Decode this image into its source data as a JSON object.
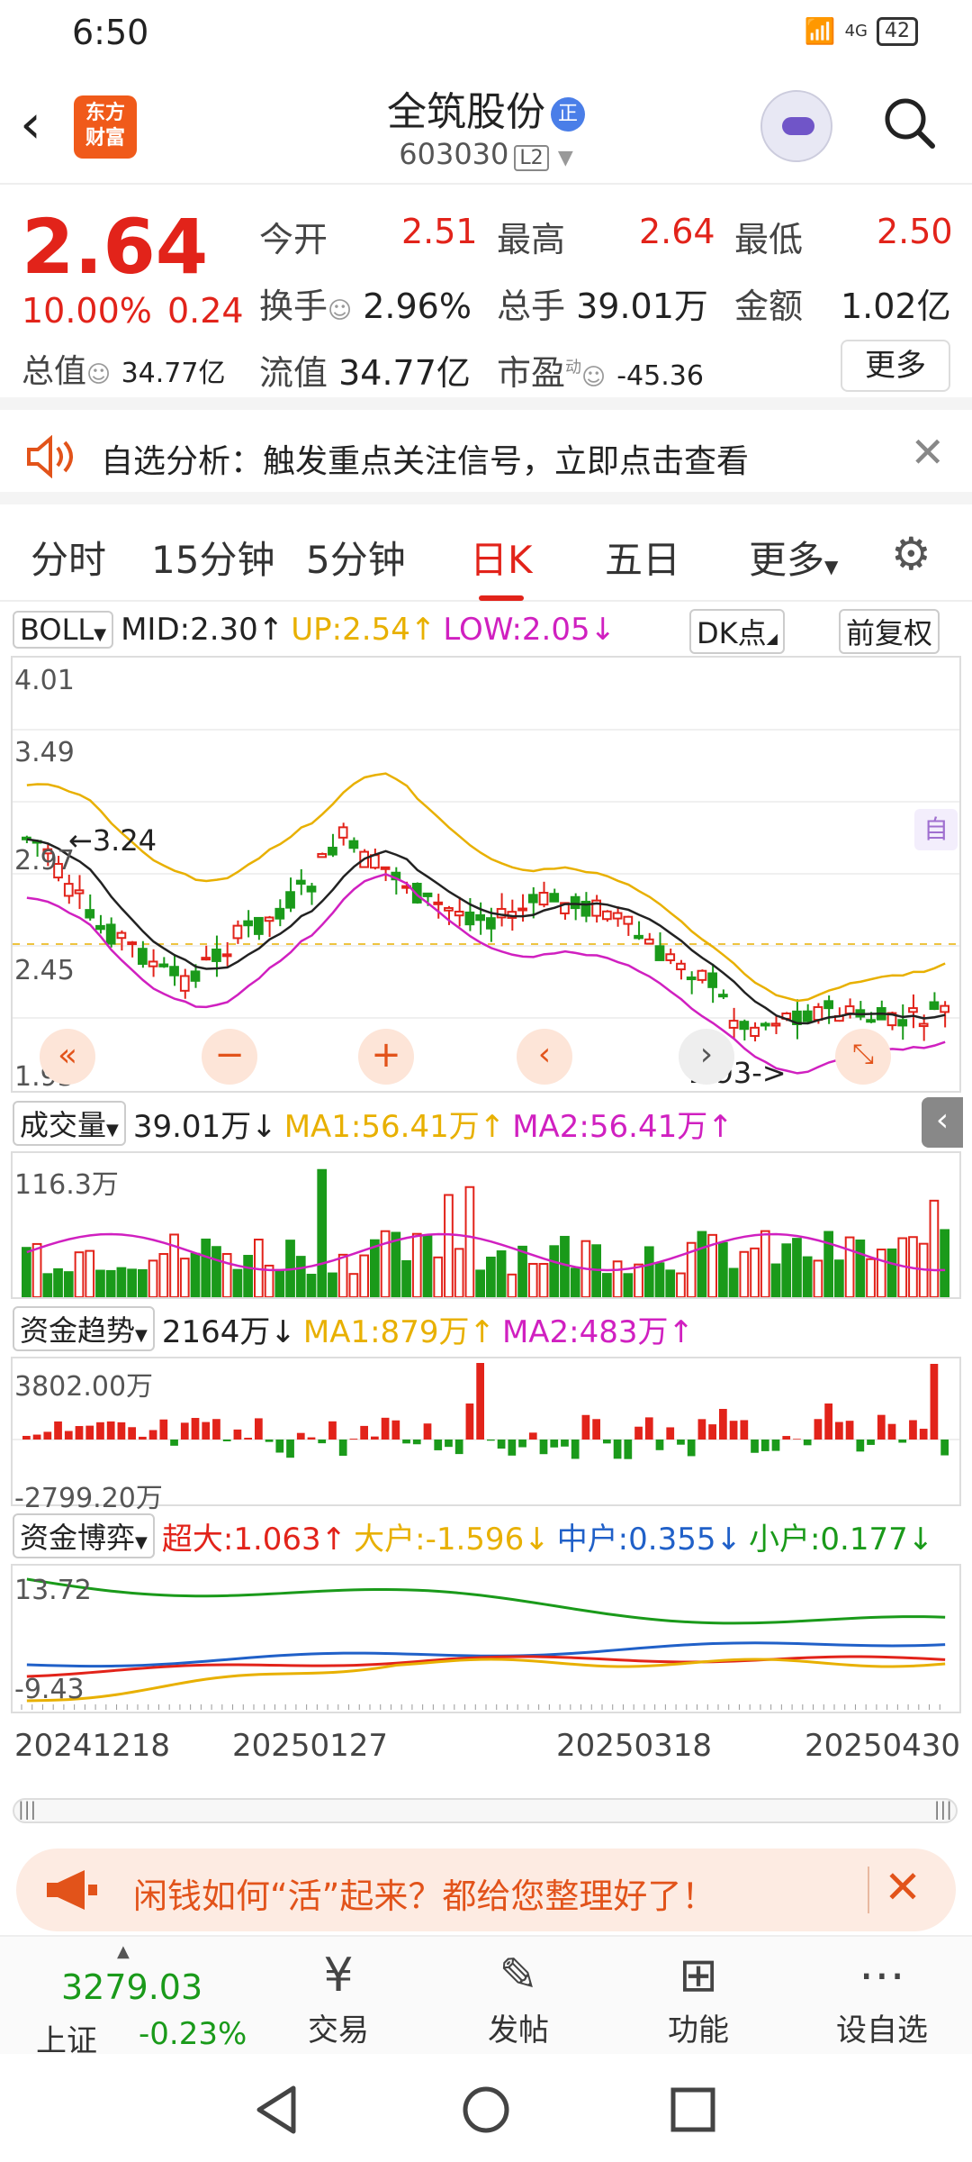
{
  "status": {
    "time": "6:50",
    "signal": "4G",
    "battery": "42"
  },
  "nav": {
    "back_glyph": "‹",
    "logo_text": "东方\n财富",
    "title": "全筑股份",
    "badge": "正",
    "code": "603030",
    "level": "L2"
  },
  "quote": {
    "price": "2.64",
    "pct": "10.00%",
    "change": "0.24",
    "open_label": "今开",
    "open": "2.51",
    "high_label": "最高",
    "high": "2.64",
    "low_label": "最低",
    "low": "2.50",
    "turnover_label": "换手",
    "turnover": "2.96%",
    "vol_label": "总手",
    "vol": "39.01万",
    "amount_label": "金额",
    "amount": "1.02亿",
    "mcap_label": "总值",
    "mcap": "34.77亿",
    "float_label": "流值",
    "float": "34.77亿",
    "pe_label": "市盈",
    "pe_sup": "动",
    "pe": "-45.36",
    "more_label": "更多"
  },
  "banner1": {
    "text": "自选分析：触发重点关注信号，立即点击查看"
  },
  "tabs": [
    {
      "label": "分时"
    },
    {
      "label": "15分钟"
    },
    {
      "label": "5分钟"
    },
    {
      "label": "日K"
    },
    {
      "label": "五日"
    },
    {
      "label": "更多"
    }
  ],
  "boll": {
    "name": "BOLL",
    "mid": "MID:2.30↑",
    "up": "UP:2.54↑",
    "low": "LOW:2.05↓",
    "dk": "DK点",
    "adj": "前复权",
    "y_labels": [
      "4.01",
      "3.49",
      "2.97",
      "2.45",
      "1.93"
    ],
    "max_note": "←3.24",
    "min_note": "1.93->",
    "self_tag": "自"
  },
  "volume": {
    "name": "成交量",
    "value": "39.01万↓",
    "ma1": "MA1:56.41万↑",
    "ma2": "MA2:56.41万↑",
    "top_label": "116.3万"
  },
  "fund_trend": {
    "name": "资金趋势",
    "value": "2164万↓",
    "ma1": "MA1:879万↑",
    "ma2": "MA2:483万↑",
    "top_label": "3802.00万",
    "bottom_label": "-2799.20万"
  },
  "fund_game": {
    "name": "资金博弈",
    "super": "超大:1.063↑",
    "big": "大户:-1.596↓",
    "mid": "中户:0.355↓",
    "small": "小户:0.177↓",
    "top_label": "13.72",
    "bottom_label": "-9.43"
  },
  "dates": [
    "20241218",
    "20250127",
    "20250318",
    "20250430"
  ],
  "banner2": {
    "text": "闲钱如何“活”起来？都给您整理好了！"
  },
  "bottom": {
    "index_value": "3279.03",
    "index_name": "上证",
    "index_change": "-0.23%",
    "items": [
      {
        "label": "交易"
      },
      {
        "label": "发帖"
      },
      {
        "label": "功能"
      },
      {
        "label": "设自选"
      }
    ]
  },
  "colors": {
    "up": "#e2231a",
    "down": "#1a9a1a",
    "mid_line": "#222222",
    "upper_band": "#e8b000",
    "lower_band": "#d020c0"
  }
}
